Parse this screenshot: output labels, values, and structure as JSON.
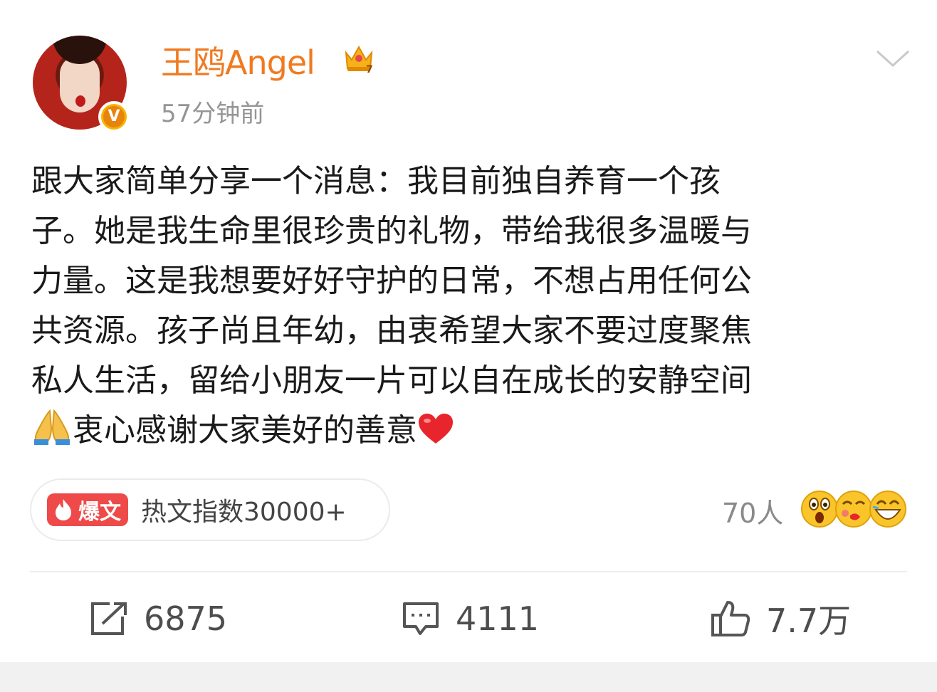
{
  "post": {
    "author": "王鸥Angel",
    "time": "57分钟前",
    "text_lines": [
      "跟大家简单分享一个消息：我目前独自养育一个孩",
      "子。她是我生命里很珍贵的礼物，带给我很多温暖与",
      "力量。这是我想要好好守护的日常，不想占用任何公",
      "共资源。孩子尚且年幼，由衷希望大家不要过度聚焦",
      "私人生活，留给小朋友一片可以自在成长的安静空间",
      "衷心感谢大家美好的善意"
    ],
    "crown_level": "7"
  },
  "hot": {
    "tag_label": "爆文",
    "index_text": "热文指数30000+"
  },
  "reactions": {
    "count_text": "70人"
  },
  "actions": {
    "repost_count": "6875",
    "comment_count": "4111",
    "like_count": "7.7万"
  },
  "colors": {
    "username": "#f07a20",
    "hot_tag": "#ee4a4a",
    "verified_badge": "#f7b500"
  },
  "icons": [
    "verified-v-icon",
    "crown-icon",
    "chevron-down-icon",
    "pray-emoji",
    "heart-emoji",
    "flame-icon",
    "surprised-face-emoji",
    "kiss-face-emoji",
    "laughing-face-emoji",
    "repost-icon",
    "comment-icon",
    "like-icon"
  ]
}
